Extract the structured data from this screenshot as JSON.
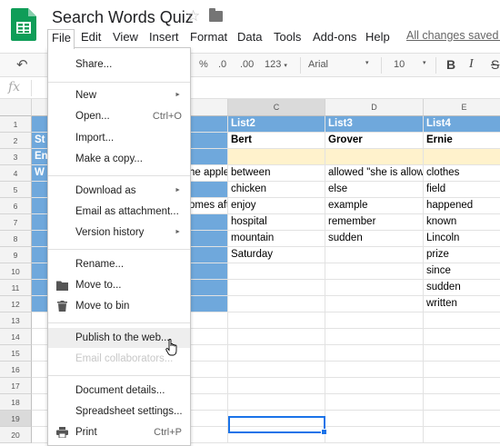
{
  "app": {
    "title": "Search Words Quiz",
    "saved_status": "All changes saved i"
  },
  "menubar": {
    "items": [
      "File",
      "Edit",
      "View",
      "Insert",
      "Format",
      "Data",
      "Tools",
      "Add-ons",
      "Help"
    ]
  },
  "toolbar": {
    "percent": "%",
    "decrease_decimal": ".0",
    "increase_decimal": ".00",
    "number_format": "123",
    "font": "Arial",
    "font_size": "10",
    "bold": "B",
    "italic": "I",
    "strike": "S"
  },
  "formula_bar": {
    "fx_label": "fx"
  },
  "columns": [
    "C",
    "D",
    "E"
  ],
  "rows": [
    "1",
    "2",
    "3",
    "4",
    "5",
    "6",
    "7",
    "8",
    "9",
    "10",
    "11",
    "12",
    "13",
    "14",
    "15",
    "16",
    "17",
    "18",
    "19",
    "20"
  ],
  "cells": {
    "header_row": [
      "List2",
      "List3",
      "List4"
    ],
    "names_row": [
      "Bert",
      "Grover",
      "Ernie"
    ],
    "col_a_row2": "St",
    "col_a_row3": "En",
    "col_a_row4": "W",
    "col_b_row4": "he apple",
    "col_b_row6": "omes aft",
    "list2": [
      "between",
      "chicken",
      "enjoy",
      "hospital",
      "mountain",
      "Saturday"
    ],
    "list3": [
      "allowed \"she is allowe",
      "else",
      "example",
      "remember",
      "sudden"
    ],
    "list4": [
      "clothes",
      "field",
      "happened",
      "known",
      "Lincoln",
      "prize",
      "since",
      "sudden",
      "written"
    ]
  },
  "file_menu": {
    "share": "Share...",
    "new": "New",
    "open": "Open...",
    "open_shortcut": "Ctrl+O",
    "import": "Import...",
    "make_copy": "Make a copy...",
    "download_as": "Download as",
    "email_attachment": "Email as attachment...",
    "version_history": "Version history",
    "rename": "Rename...",
    "move_to": "Move to...",
    "move_to_bin": "Move to bin",
    "publish": "Publish to the web...",
    "email_collaborators": "Email collaborators...",
    "document_details": "Document details...",
    "spreadsheet_settings": "Spreadsheet settings...",
    "print": "Print",
    "print_shortcut": "Ctrl+P"
  },
  "colors": {
    "header_blue": "#6fa8dc",
    "row3_yellow": "#fff2cc",
    "selection_blue": "#1a73e8",
    "sheets_green": "#0f9d58"
  }
}
